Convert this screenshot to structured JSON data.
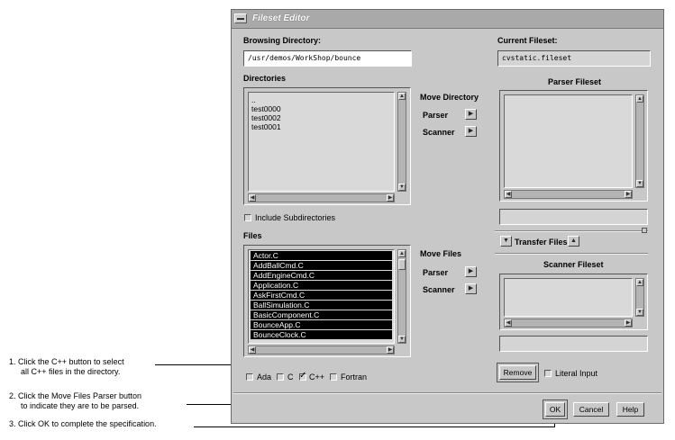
{
  "window": {
    "title": "Fileset Editor"
  },
  "browsing": {
    "label": "Browsing Directory:",
    "path": "/usr/demos/WorkShop/bounce"
  },
  "current": {
    "label": "Current Fileset:",
    "value": "cvstatic.fileset"
  },
  "directories": {
    "label": "Directories",
    "items": [
      "..",
      "test0000",
      "test0002",
      "test0001"
    ]
  },
  "move_directory": {
    "label": "Move Directory",
    "parser": "Parser",
    "scanner": "Scanner"
  },
  "include_subdirs": {
    "label": "Include Subdirectories",
    "checked": false
  },
  "parser_fileset": {
    "label": "Parser Fileset"
  },
  "transfer": {
    "label": "Transfer Files"
  },
  "scanner_fileset": {
    "label": "Scanner Fileset"
  },
  "files": {
    "label": "Files",
    "items": [
      "Actor.C",
      "AddBallCmd.C",
      "AddEngineCmd.C",
      "Application.C",
      "AskFirstCmd.C",
      "BallSimulation.C",
      "BasicComponent.C",
      "BounceApp.C",
      "BounceClock.C"
    ]
  },
  "move_files": {
    "label": "Move Files",
    "parser": "Parser",
    "scanner": "Scanner"
  },
  "filters": {
    "ada": "Ada",
    "c": "C",
    "cpp": "C++",
    "fortran": "Fortran",
    "cpp_checked": true
  },
  "remove": {
    "label": "Remove"
  },
  "literal": {
    "label": "Literal Input"
  },
  "buttons": {
    "ok": "OK",
    "cancel": "Cancel",
    "help": "Help"
  },
  "callouts": {
    "c1_line1": "1. Click the C++ button to select",
    "c1_line2": "all C++ files in the directory.",
    "c2_line1": "2. Click the Move Files Parser button",
    "c2_line2": "to indicate they are to be parsed.",
    "c3_line1": "3. Click OK to complete the specification."
  }
}
